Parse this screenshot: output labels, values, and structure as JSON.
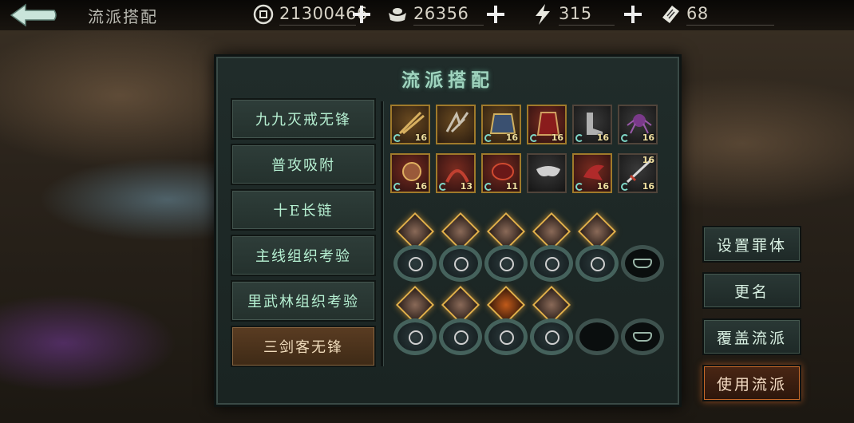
{
  "header": {
    "title": "流派搭配",
    "resources": [
      {
        "icon": "coin-icon",
        "value": "21300466"
      },
      {
        "icon": "silver-ingot-icon",
        "value": "26356"
      },
      {
        "icon": "lightning-stamina-icon",
        "value": "315"
      },
      {
        "icon": "ticket-icon",
        "value": "68"
      }
    ]
  },
  "panel": {
    "title": "流派搭配",
    "schools": [
      {
        "label": "九九灭戒无锋"
      },
      {
        "label": "普攻吸附"
      },
      {
        "label": "十E长链"
      },
      {
        "label": "主线组织考验"
      },
      {
        "label": "里武林组织考验"
      },
      {
        "label": "三剑客无锋",
        "active": true
      }
    ],
    "equipment_row1": [
      {
        "level": "16"
      },
      {
        "level": ""
      },
      {
        "level": "16"
      },
      {
        "level": "16"
      },
      {
        "level": "16"
      },
      {
        "level": "16"
      }
    ],
    "equipment_row2": [
      {
        "level": "16"
      },
      {
        "level": "13"
      },
      {
        "level": "11"
      },
      {
        "level": ""
      },
      {
        "level": "16"
      },
      {
        "level": "16",
        "top_level": "16"
      }
    ]
  },
  "actions": {
    "set_body": "设置罪体",
    "rename": "更名",
    "overwrite": "覆盖流派",
    "use": "使用流派"
  }
}
